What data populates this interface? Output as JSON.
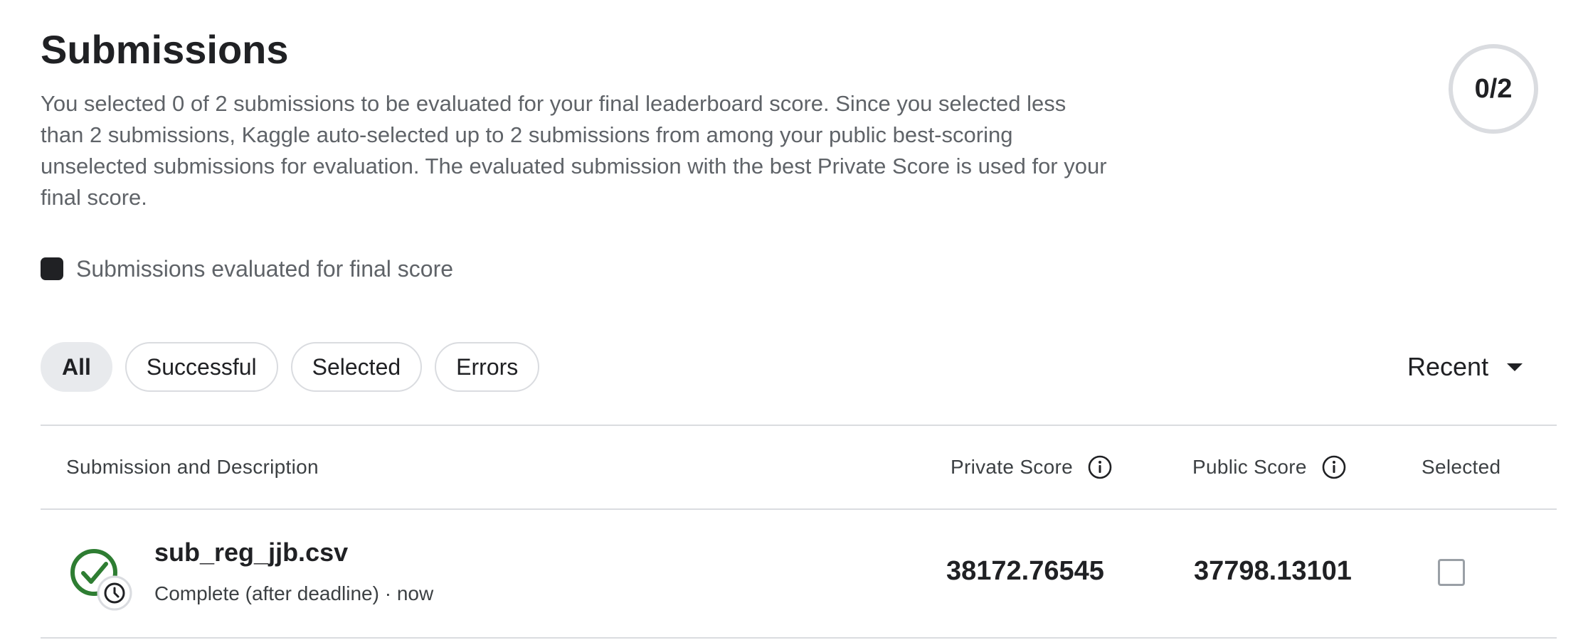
{
  "header": {
    "title": "Submissions",
    "description": "You selected 0 of 2 submissions to be evaluated for your final leaderboard score. Since you selected less than 2 submissions, Kaggle auto-selected up to 2 submissions from among your public best-scoring unselected submissions for evaluation. The evaluated submission with the best Private Score is used for your final score.",
    "counter": "0/2"
  },
  "legend": {
    "label": "Submissions evaluated for final score",
    "swatch_color": "#202124"
  },
  "filters": {
    "chips": [
      {
        "label": "All",
        "active": true
      },
      {
        "label": "Successful",
        "active": false
      },
      {
        "label": "Selected",
        "active": false
      },
      {
        "label": "Errors",
        "active": false
      }
    ],
    "sort": {
      "label": "Recent",
      "icon": "caret-down-icon"
    }
  },
  "table": {
    "columns": {
      "submission": "Submission and Description",
      "private_score": "Private Score",
      "public_score": "Public Score",
      "selected": "Selected"
    },
    "rows": [
      {
        "file_name": "sub_reg_jjb.csv",
        "status": "Complete (after deadline) · now",
        "private_score": "38172.76545",
        "public_score": "37798.13101",
        "selected": false,
        "status_icon": "check-circle-icon",
        "badge_icon": "clock-icon"
      }
    ]
  },
  "colors": {
    "success_green": "#2e7d32",
    "text_primary": "#202124",
    "text_secondary": "#5f6368",
    "border": "#dadce0"
  }
}
